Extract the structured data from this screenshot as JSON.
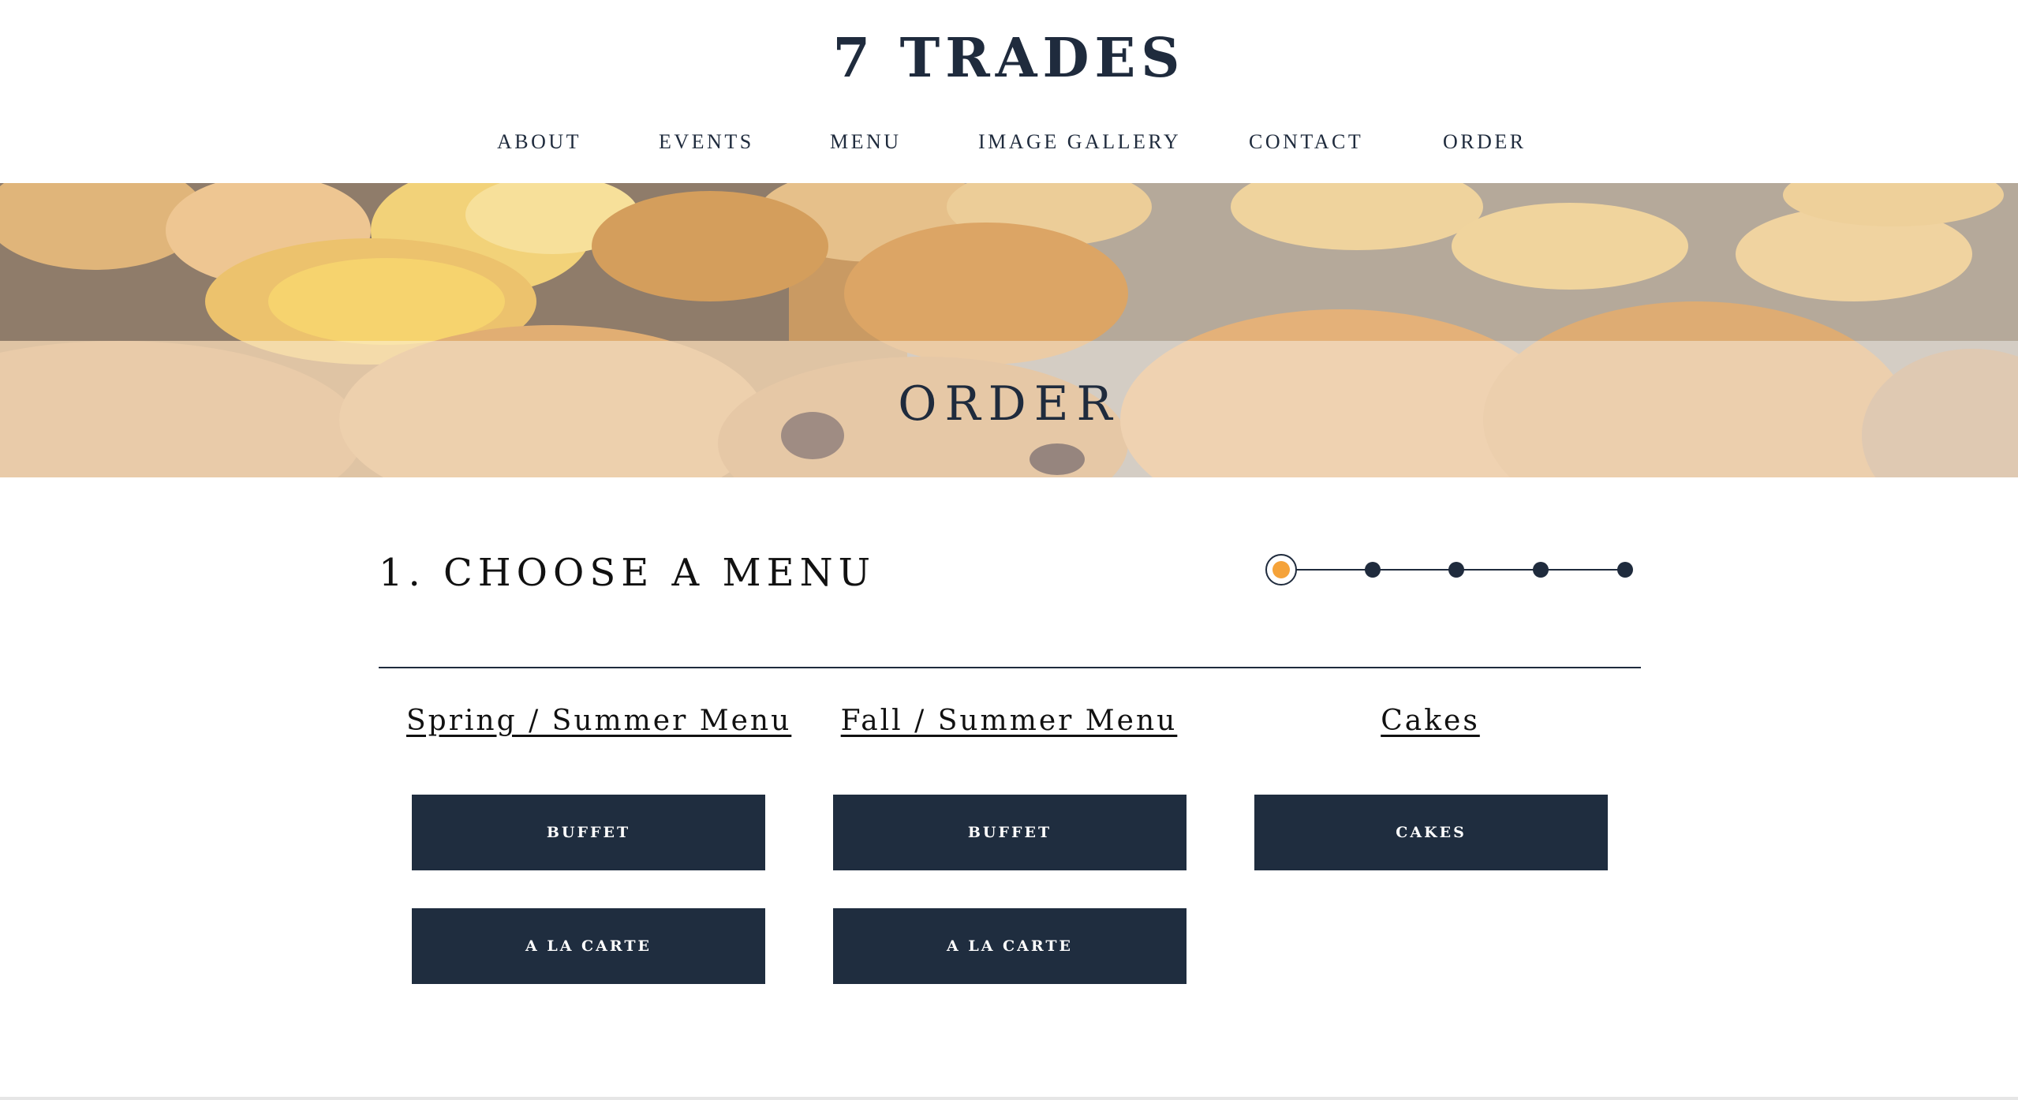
{
  "site": {
    "logo": "7 TRADES"
  },
  "nav": [
    {
      "label": "ABOUT"
    },
    {
      "label": "EVENTS"
    },
    {
      "label": "MENU"
    },
    {
      "label": "IMAGE GALLERY"
    },
    {
      "label": "CONTACT"
    },
    {
      "label": "ORDER"
    }
  ],
  "hero": {
    "title": "ORDER"
  },
  "step": {
    "title": "1. CHOOSE A MENU",
    "current_step": 1,
    "total_steps": 5
  },
  "colors": {
    "navy": "#1f2d3f",
    "active_dot": "#f5a33a"
  },
  "menus": [
    {
      "title": "Spring / Summer Menu",
      "buttons": [
        "BUFFET",
        "A LA CARTE"
      ]
    },
    {
      "title": "Fall / Summer Menu",
      "buttons": [
        "BUFFET",
        "A LA CARTE"
      ]
    },
    {
      "title": "Cakes",
      "buttons": [
        "CAKES"
      ]
    }
  ]
}
